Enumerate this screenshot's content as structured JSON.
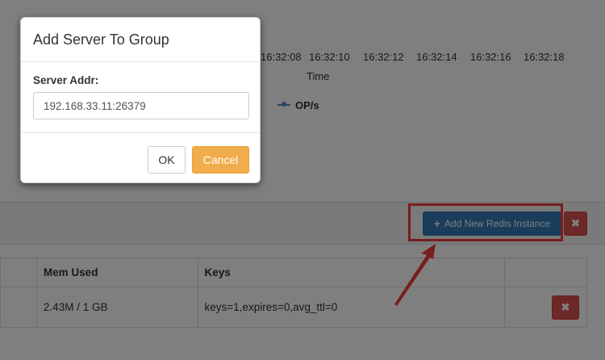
{
  "chart": {
    "time_ticks": [
      "16:32:08",
      "16:32:10",
      "16:32:12",
      "16:32:14",
      "16:32:16",
      "16:32:18"
    ],
    "axis_title": "Time",
    "legend_label": "OP/s",
    "series_color": "#5b8cc9"
  },
  "group_panel": {
    "add_instance_label": "Add New Redis Instance",
    "remove_group_symbol": "✖",
    "table": {
      "headers": [
        "",
        "Mem Used",
        "Keys",
        ""
      ],
      "rows": [
        {
          "mem_used": "2.43M / 1 GB",
          "keys": "keys=1,expires=0,avg_ttl=0",
          "remove_symbol": "✖"
        }
      ]
    }
  },
  "modal": {
    "title": "Add Server To Group",
    "field_label": "Server Addr:",
    "field_value": "192.168.33.11:26379",
    "ok_label": "OK",
    "cancel_label": "Cancel"
  },
  "colors": {
    "primary": "#337ab7",
    "danger": "#d9534f",
    "warning": "#f0ad4e",
    "annotation": "#f23b3b"
  }
}
